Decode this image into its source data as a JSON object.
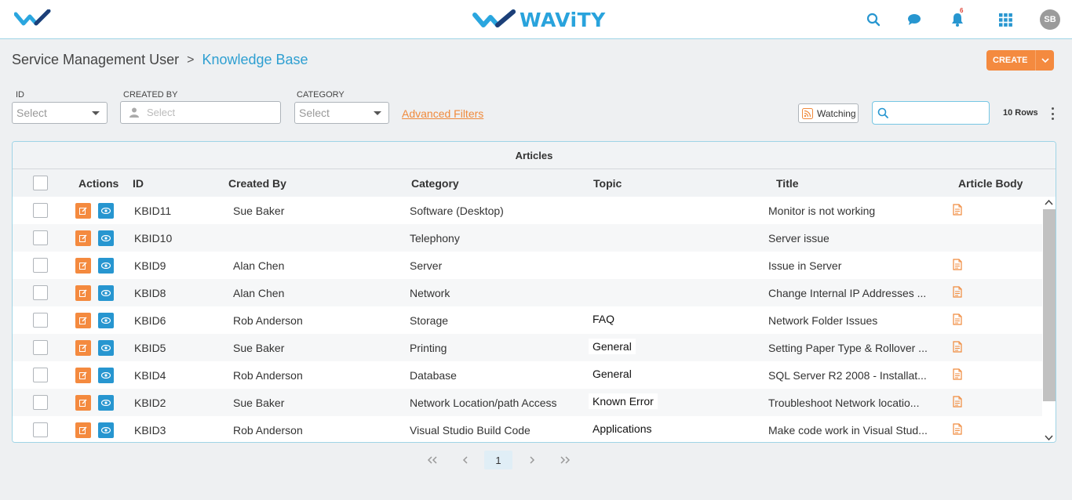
{
  "header": {
    "brand": "WAViTY",
    "bell_count": "6",
    "avatar_initials": "SB",
    "accent": "#29a3dc"
  },
  "breadcrumb": {
    "parent": "Service Management User",
    "separator": ">",
    "current": "Knowledge Base"
  },
  "toolbar": {
    "create_label": "CREATE",
    "watching_label": "Watching",
    "rows_label": "10 Rows",
    "search_placeholder": "",
    "create_color": "#f48a3f"
  },
  "filters": {
    "id_label": "ID",
    "id_value": "Select",
    "created_by_label": "CREATED BY",
    "created_by_placeholder": "Select",
    "category_label": "CATEGORY",
    "category_value": "Select",
    "advanced": "Advanced Filters"
  },
  "table": {
    "title": "Articles",
    "columns": [
      "Actions",
      "ID",
      "Created By",
      "Category",
      "Topic",
      "Title",
      "Article Body"
    ],
    "rows": [
      {
        "id": "KBID11",
        "created_by": "Sue Baker",
        "category": "Software (Desktop)",
        "topic": "",
        "title": "Monitor is not working",
        "has_body": true
      },
      {
        "id": "KBID10",
        "created_by": "",
        "category": "Telephony",
        "topic": "",
        "title": "Server issue",
        "has_body": false
      },
      {
        "id": "KBID9",
        "created_by": "Alan Chen",
        "category": "Server",
        "topic": "",
        "title": "Issue in Server",
        "has_body": true
      },
      {
        "id": "KBID8",
        "created_by": "Alan Chen",
        "category": "Network",
        "topic": "",
        "title": "Change Internal IP Addresses ...",
        "has_body": true
      },
      {
        "id": "KBID6",
        "created_by": "Rob Anderson",
        "category": "Storage",
        "topic": "FAQ",
        "title": "Network Folder Issues",
        "has_body": true
      },
      {
        "id": "KBID5",
        "created_by": "Sue Baker",
        "category": "Printing",
        "topic": "General",
        "title": "Setting Paper Type & Rollover ...",
        "has_body": true
      },
      {
        "id": "KBID4",
        "created_by": "Rob Anderson",
        "category": "Database",
        "topic": "General",
        "title": "SQL Server R2 2008 - Installat...",
        "has_body": true
      },
      {
        "id": "KBID2",
        "created_by": "Sue Baker",
        "category": "Network Location/path Access",
        "topic": "Known Error",
        "title": "Troubleshoot Network locatio...",
        "has_body": true
      },
      {
        "id": "KBID3",
        "created_by": "Rob Anderson",
        "category": "Visual Studio Build Code",
        "topic": "Applications",
        "title": "Make code work in Visual Stud...",
        "has_body": true
      }
    ]
  },
  "pagination": {
    "current_page": "1"
  }
}
